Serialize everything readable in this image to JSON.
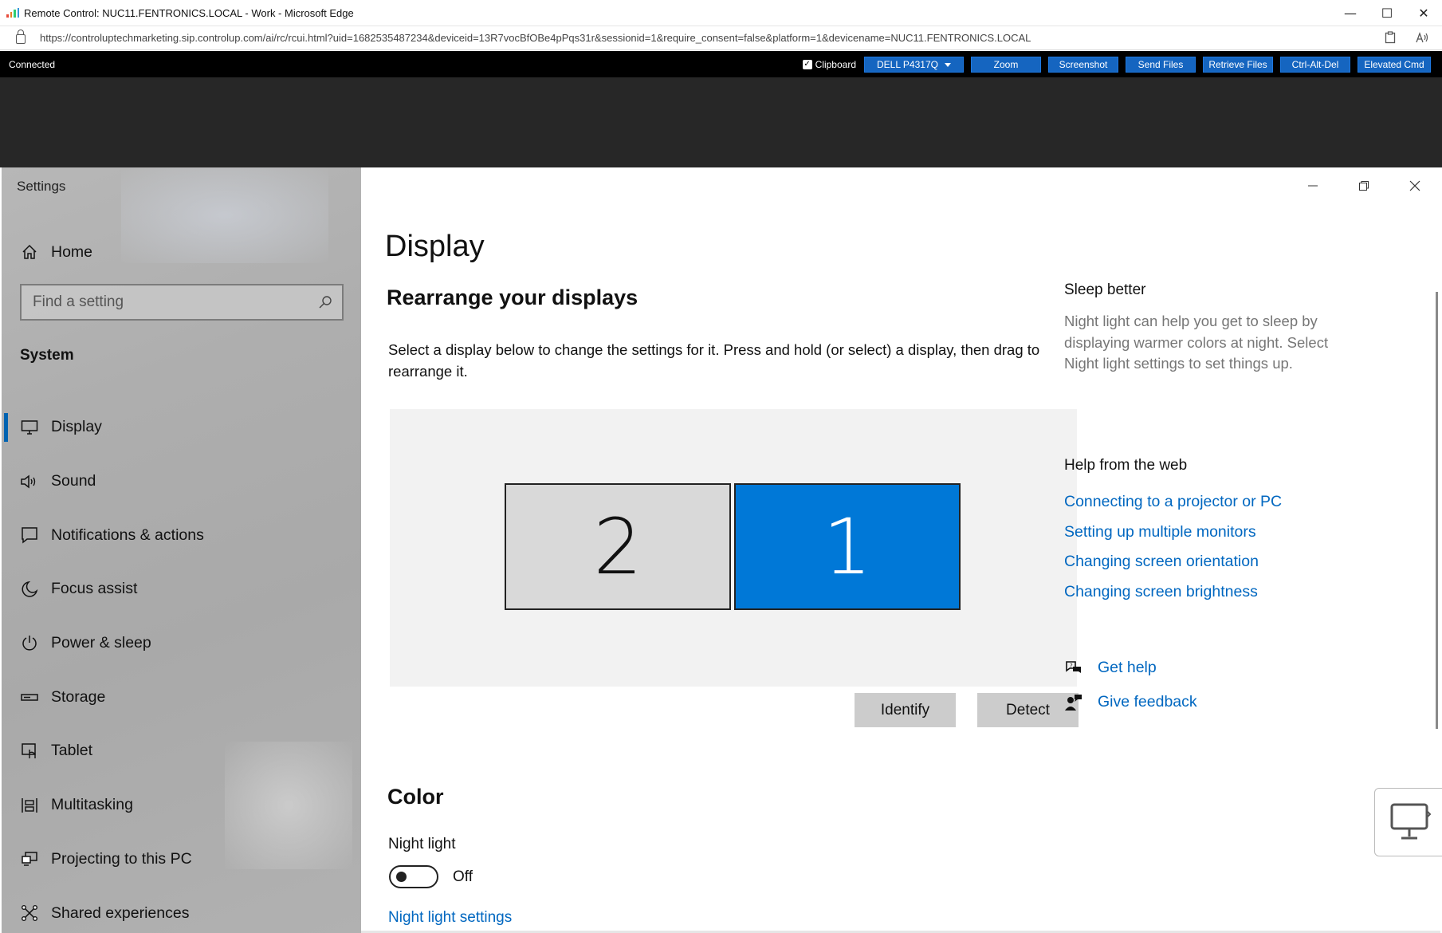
{
  "browser": {
    "title": "Remote Control: NUC11.FENTRONICS.LOCAL - Work - Microsoft Edge",
    "url": "https://controluptechmarketing.sip.controlup.com/ai/rc/rcui.html?uid=1682535487234&deviceid=13R7vocBfOBe4pPqs31r&sessionid=1&require_consent=false&platform=1&devicename=NUC11.FENTRONICS.LOCAL",
    "controls": {
      "minimize": "—",
      "maximize": "☐",
      "close": "✕"
    }
  },
  "remote_toolbar": {
    "status": "Connected",
    "clipboard_label": "Clipboard",
    "clipboard_checked": true,
    "monitor_select": "DELL P4317Q",
    "buttons": [
      "Zoom",
      "Screenshot",
      "Send Files",
      "Retrieve Files",
      "Ctrl-Alt-Del",
      "Elevated Cmd"
    ],
    "accent_color": "#1565c0"
  },
  "settings": {
    "window_title": "Settings",
    "home_label": "Home",
    "search_placeholder": "Find a setting",
    "section_label": "System",
    "nav_items": [
      {
        "label": "Display",
        "icon": "monitor-icon",
        "active": true
      },
      {
        "label": "Sound",
        "icon": "speaker-icon",
        "active": false
      },
      {
        "label": "Notifications & actions",
        "icon": "notification-icon",
        "active": false
      },
      {
        "label": "Focus assist",
        "icon": "moon-icon",
        "active": false
      },
      {
        "label": "Power & sleep",
        "icon": "power-icon",
        "active": false
      },
      {
        "label": "Storage",
        "icon": "storage-icon",
        "active": false
      },
      {
        "label": "Tablet",
        "icon": "tablet-icon",
        "active": false
      },
      {
        "label": "Multitasking",
        "icon": "multitasking-icon",
        "active": false
      },
      {
        "label": "Projecting to this PC",
        "icon": "projecting-icon",
        "active": false
      },
      {
        "label": "Shared experiences",
        "icon": "shared-icon",
        "active": false
      }
    ],
    "accent_color": "#0078d7"
  },
  "display": {
    "page_title": "Display",
    "rearrange_heading": "Rearrange your displays",
    "rearrange_text": "Select a display below to change the settings for it. Press and hold (or select) a display, then drag to rearrange it.",
    "monitors": [
      {
        "label": "2",
        "selected": false
      },
      {
        "label": "1",
        "selected": true
      }
    ],
    "identify_label": "Identify",
    "detect_label": "Detect",
    "color_heading": "Color",
    "night_light_label": "Night light",
    "night_light_state": "Off",
    "night_light_settings_link": "Night light settings"
  },
  "aside": {
    "sleep_heading": "Sleep better",
    "sleep_text": "Night light can help you get to sleep by displaying warmer colors at night. Select Night light settings to set things up.",
    "help_heading": "Help from the web",
    "help_links": [
      "Connecting to a projector or PC",
      "Setting up multiple monitors",
      "Changing screen orientation",
      "Changing screen brightness"
    ],
    "get_help": "Get help",
    "give_feedback": "Give feedback"
  }
}
